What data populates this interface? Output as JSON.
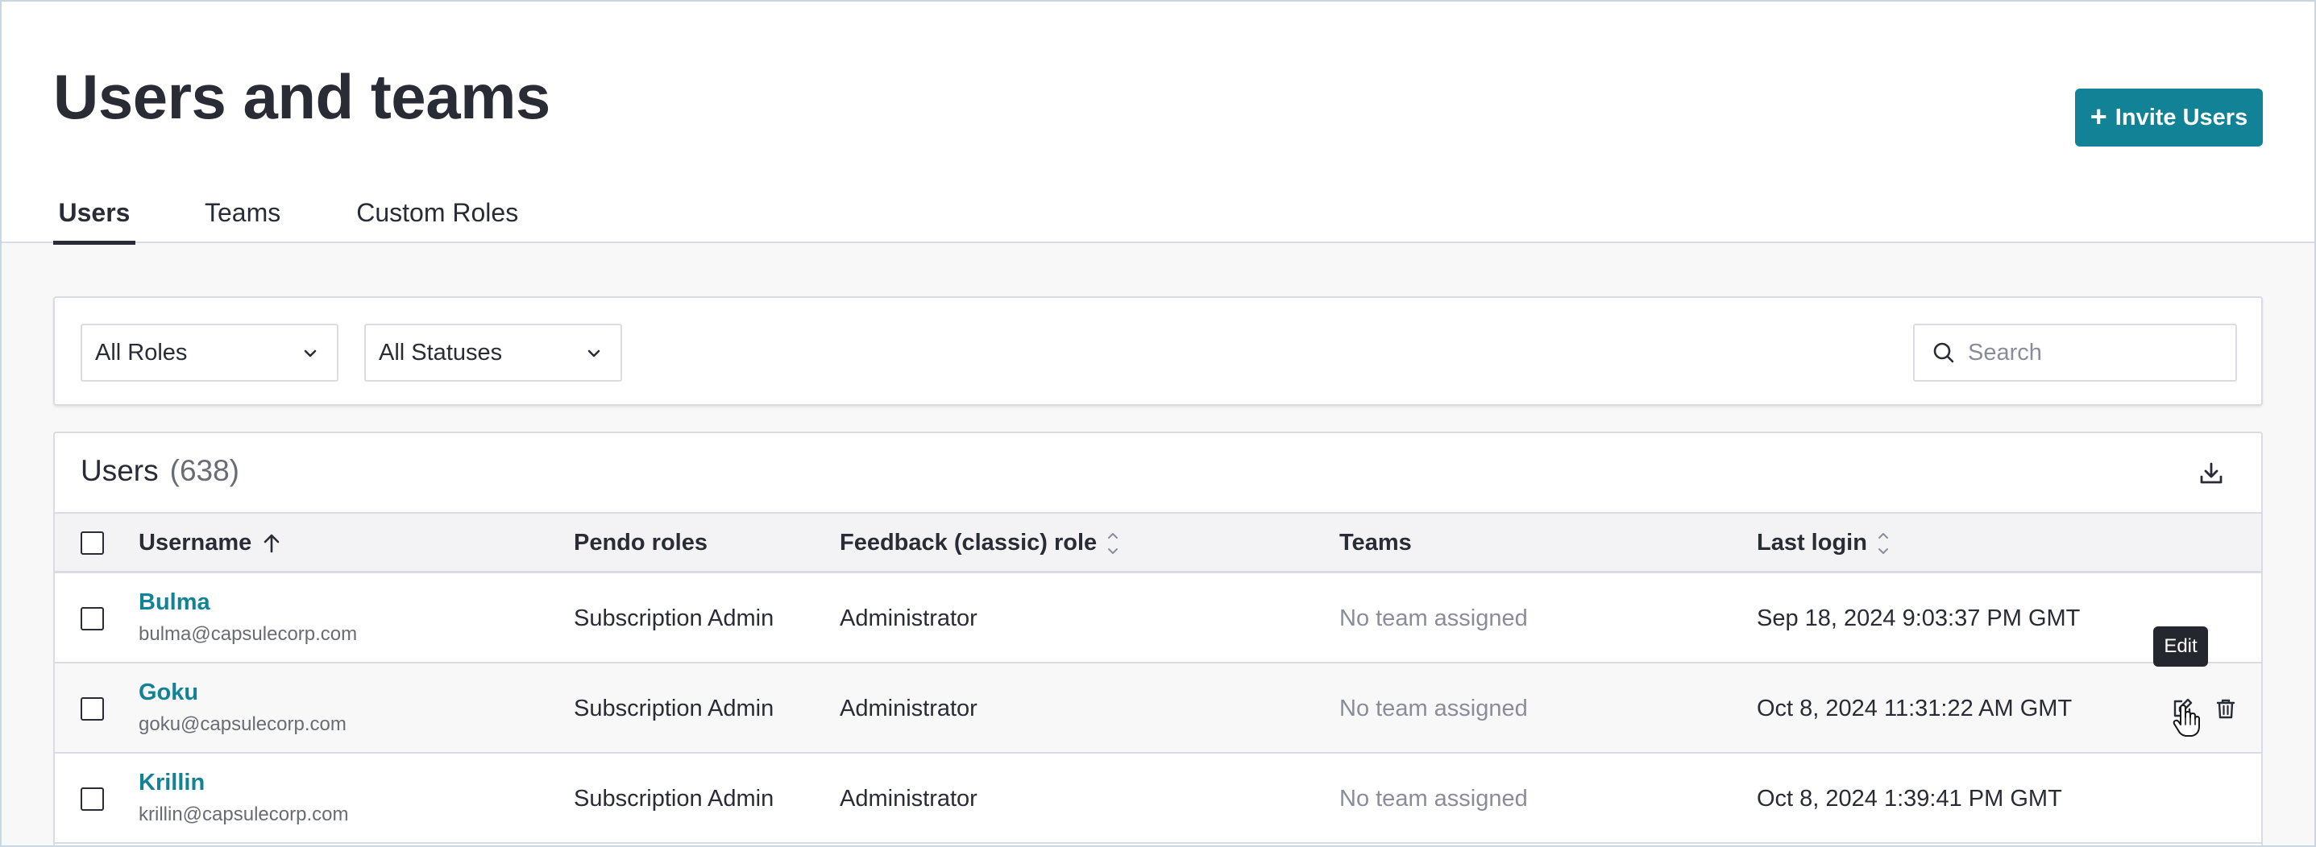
{
  "page": {
    "title": "Users and teams",
    "invite_button": "Invite Users",
    "invite_icon": "+",
    "tabs": [
      {
        "label": "Users",
        "active": true
      },
      {
        "label": "Teams",
        "active": false
      },
      {
        "label": "Custom Roles",
        "active": false
      }
    ]
  },
  "filters": {
    "roles_select": "All Roles",
    "status_select": "All Statuses",
    "search_placeholder": "Search"
  },
  "table": {
    "title": "Users",
    "count": "(638)",
    "columns": {
      "username": "Username",
      "pendo_roles": "Pendo roles",
      "feedback_role": "Feedback (classic) role",
      "teams": "Teams",
      "last_login": "Last login"
    },
    "rows": [
      {
        "name": "Bulma",
        "email": "bulma@capsulecorp.com",
        "pendo_role": "Subscription Admin",
        "feedback_role": "Administrator",
        "teams": "No team assigned",
        "last_login": "Sep 18, 2024 9:03:37 PM GMT"
      },
      {
        "name": "Goku",
        "email": "goku@capsulecorp.com",
        "pendo_role": "Subscription Admin",
        "feedback_role": "Administrator",
        "teams": "No team assigned",
        "last_login": "Oct 8, 2024 11:31:22 AM GMT"
      },
      {
        "name": "Krillin",
        "email": "krillin@capsulecorp.com",
        "pendo_role": "Subscription Admin",
        "feedback_role": "Administrator",
        "teams": "No team assigned",
        "last_login": "Oct 8, 2024 1:39:41 PM GMT"
      }
    ],
    "tooltip": "Edit"
  },
  "colors": {
    "accent": "#128297",
    "text": "#2a2c35",
    "muted": "#8a8d99",
    "border": "#dadce5"
  },
  "icons": [
    "plus-icon",
    "chevron-down-icon",
    "search-icon",
    "download-icon",
    "sort-ascending-icon",
    "sort-arrows-icon",
    "edit-icon",
    "trash-icon",
    "hand-cursor-icon"
  ]
}
